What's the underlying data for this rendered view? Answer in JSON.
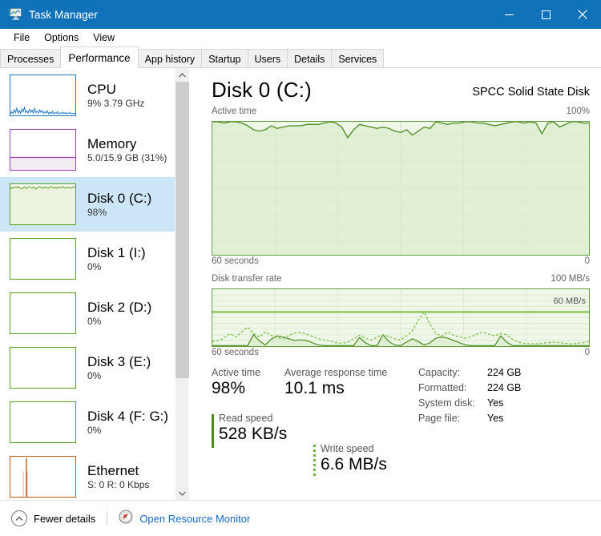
{
  "window": {
    "title": "Task Manager",
    "icon": "task-manager-icon",
    "minimize": "–",
    "maximize": "□",
    "close": "✕"
  },
  "menu": {
    "items": [
      "File",
      "Options",
      "View"
    ]
  },
  "tabs": {
    "items": [
      {
        "label": "Processes",
        "active": false
      },
      {
        "label": "Performance",
        "active": true
      },
      {
        "label": "App history",
        "active": false
      },
      {
        "label": "Startup",
        "active": false
      },
      {
        "label": "Users",
        "active": false
      },
      {
        "label": "Details",
        "active": false
      },
      {
        "label": "Services",
        "active": false
      }
    ]
  },
  "sidebar": {
    "items": [
      {
        "title": "CPU",
        "sub": "9%  3.79 GHz",
        "accent": "#1f77c4",
        "thumb": "cpu-line",
        "selected": false
      },
      {
        "title": "Memory",
        "sub": "5.0/15.9 GB (31%)",
        "accent": "#9b3fb5",
        "thumb": "memory-fill",
        "selected": false
      },
      {
        "title": "Disk 0 (C:)",
        "sub": "98%",
        "accent": "#57a218",
        "thumb": "disk-active",
        "selected": true
      },
      {
        "title": "Disk 1 (I:)",
        "sub": "0%",
        "accent": "#57a218",
        "thumb": "empty",
        "selected": false
      },
      {
        "title": "Disk 2 (D:)",
        "sub": "0%",
        "accent": "#57a218",
        "thumb": "empty",
        "selected": false
      },
      {
        "title": "Disk 3 (E:)",
        "sub": "0%",
        "accent": "#57a218",
        "thumb": "empty",
        "selected": false
      },
      {
        "title": "Disk 4 (F: G:)",
        "sub": "0%",
        "accent": "#57a218",
        "thumb": "empty",
        "selected": false
      },
      {
        "title": "Ethernet",
        "sub": "S: 0 R: 0 Kbps",
        "accent": "#c25a17",
        "thumb": "ethernet-spikes",
        "selected": false
      }
    ]
  },
  "panel": {
    "title": "Disk 0 (C:)",
    "subtitle": "SPCC Solid State Disk",
    "active_graph": {
      "label": "Active time",
      "max_label": "100%",
      "x_label": "60 seconds",
      "min_label": "0"
    },
    "transfer_graph": {
      "label": "Disk transfer rate",
      "max_label": "100 MB/s",
      "marker_label": "60 MB/s",
      "x_label": "60 seconds",
      "min_label": "0"
    },
    "stats": {
      "active_time_label": "Active time",
      "active_time_value": "98%",
      "response_label": "Average response time",
      "response_value": "10.1 ms",
      "read_label": "Read speed",
      "read_value": "528 KB/s",
      "write_label": "Write speed",
      "write_value": "6.6 MB/s"
    },
    "info": [
      {
        "key": "Capacity:",
        "value": "224 GB"
      },
      {
        "key": "Formatted:",
        "value": "224 GB"
      },
      {
        "key": "System disk:",
        "value": "Yes"
      },
      {
        "key": "Page file:",
        "value": "Yes"
      }
    ]
  },
  "statusbar": {
    "fewer_details": "Fewer details",
    "resource_monitor": "Open Resource Monitor"
  },
  "colors": {
    "titlebar": "#1073ba",
    "selection": "#cde6f7",
    "disk_green": "#66a03c",
    "disk_green_dark": "#4a8a1f",
    "disk_fill": "#eff7e8",
    "link": "#1569c7"
  },
  "chart_data": [
    {
      "type": "area",
      "title": "Active time",
      "ylabel": "",
      "xlabel": "60 seconds",
      "ylim": [
        0,
        100
      ],
      "y_max_label": "100%",
      "y_min_label": "0",
      "grid": true,
      "series": [
        {
          "name": "Active time",
          "values": [
            100,
            100,
            99,
            100,
            100,
            99,
            97,
            94,
            93,
            94,
            97,
            95,
            96,
            97,
            97,
            97,
            98,
            98,
            98,
            99,
            100,
            99,
            96,
            88,
            94,
            98,
            97,
            96,
            95,
            96,
            95,
            93,
            92,
            94,
            90,
            93,
            96,
            95,
            100,
            99,
            98,
            99,
            99,
            100,
            100,
            99,
            99,
            98,
            97,
            98,
            99,
            100,
            100,
            99,
            100,
            99,
            91,
            99,
            100,
            96,
            98,
            100,
            100,
            99,
            99
          ]
        }
      ]
    },
    {
      "type": "line",
      "title": "Disk transfer rate",
      "ylabel": "",
      "xlabel": "60 seconds",
      "ylim": [
        0,
        100
      ],
      "y_max_label": "100 MB/s",
      "y_min_label": "0",
      "marker_line": {
        "label": "60 MB/s",
        "value": 60
      },
      "grid": true,
      "series": [
        {
          "name": "Read speed",
          "style": "dashed",
          "color": "#7cc043",
          "values": [
            8,
            10,
            14,
            22,
            16,
            25,
            33,
            22,
            16,
            25,
            19,
            15,
            13,
            19,
            23,
            24,
            21,
            17,
            13,
            11,
            9,
            6,
            5,
            7,
            13,
            19,
            14,
            11,
            16,
            20,
            17,
            13,
            11,
            18,
            27,
            46,
            60,
            38,
            22,
            18,
            25,
            19,
            16,
            14,
            17,
            21,
            25,
            21,
            18,
            22,
            20,
            12,
            7,
            5,
            4,
            4,
            5,
            6,
            7,
            6,
            5,
            4,
            5,
            6,
            8
          ]
        },
        {
          "name": "Write speed",
          "style": "solid-fill",
          "color": "#4a8a1f",
          "values": [
            1,
            1,
            1,
            1,
            1,
            1,
            1,
            20,
            9,
            2,
            12,
            18,
            16,
            13,
            10,
            11,
            10,
            6,
            2,
            1,
            1,
            1,
            1,
            1,
            1,
            15,
            6,
            1,
            1,
            20,
            8,
            2,
            1,
            7,
            13,
            8,
            2,
            6,
            14,
            16,
            14,
            10,
            6,
            2,
            1,
            1,
            1,
            1,
            1,
            18,
            7,
            1,
            1,
            1,
            1,
            1,
            1,
            1,
            1,
            1,
            1,
            1,
            1,
            1,
            1
          ]
        }
      ]
    }
  ]
}
